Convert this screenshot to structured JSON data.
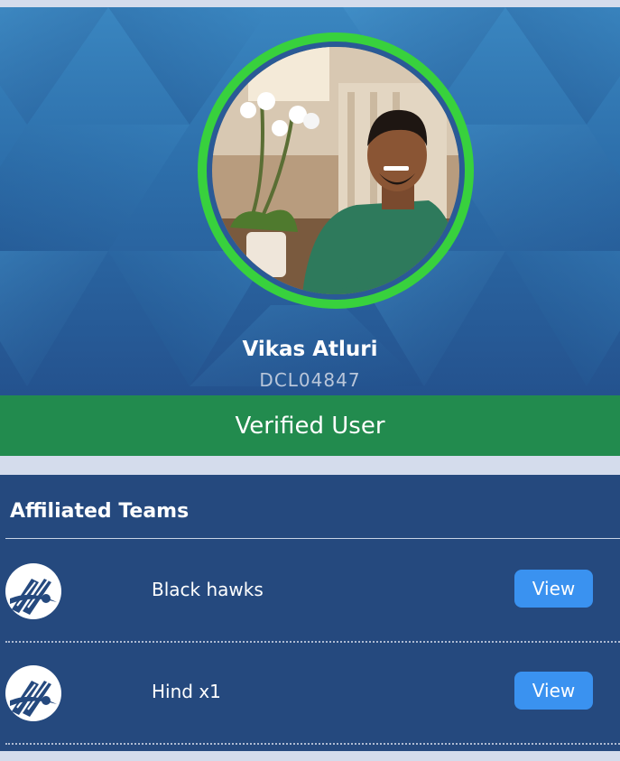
{
  "profile": {
    "name": "Vikas Atluri",
    "id": "DCL04847",
    "avatar_icon": "user-photo",
    "ring_color": "#38d13d"
  },
  "verified": {
    "label": "Verified User",
    "color": "#228b4e"
  },
  "teams": {
    "title": "Affiliated Teams",
    "items": [
      {
        "name": "Black hawks",
        "action_label": "View",
        "logo_icon": "cricket-bat-logo-icon"
      },
      {
        "name": "Hind x1",
        "action_label": "View",
        "logo_icon": "cricket-bat-logo-icon"
      }
    ]
  },
  "colors": {
    "hero_top": "#3a86c0",
    "hero_bottom": "#24528e",
    "card_bg": "#25497e",
    "button_bg": "#3a92f0"
  }
}
